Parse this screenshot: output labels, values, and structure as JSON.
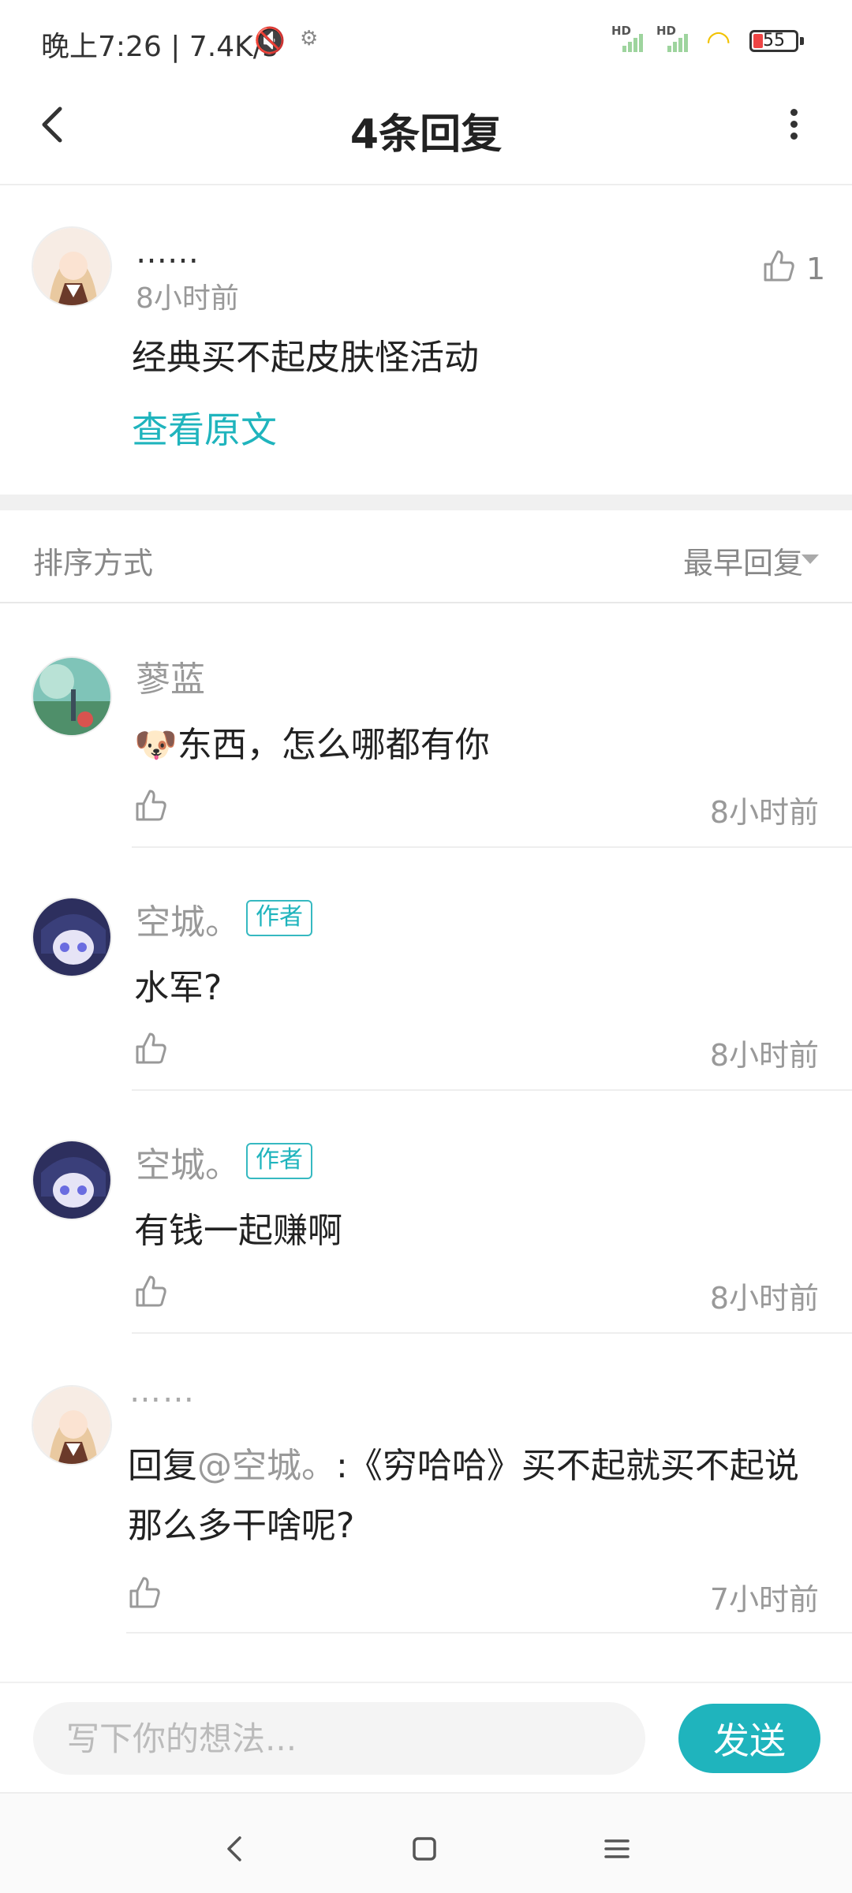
{
  "status_bar": {
    "time": "晚上7:26 | 7.4K/s",
    "sim1": "HD",
    "sim2": "HD",
    "battery": "55"
  },
  "header": {
    "title": "4条回复"
  },
  "main_comment": {
    "name": "……",
    "time": "8小时前",
    "text": "经典买不起皮肤怪活动",
    "view_original": "查看原文",
    "likes": "1"
  },
  "sort": {
    "label": "排序方式",
    "value": "最早回复"
  },
  "replies": [
    {
      "name": "蓼蓝",
      "badge": "",
      "text": "🐶东西，怎么哪都有你",
      "time": "8小时前"
    },
    {
      "name": "空城。",
      "badge": "作者",
      "text": "水军?",
      "time": "8小时前"
    },
    {
      "name": "空城。",
      "badge": "作者",
      "text": "有钱一起赚啊",
      "time": "8小时前"
    },
    {
      "name": "……",
      "badge": "",
      "text_prefix": "回复",
      "mention": "@空城。",
      "text": ":《穷哈哈》买不起就买不起说那么多干啥呢?",
      "time": "7小时前"
    }
  ],
  "composer": {
    "placeholder": "写下你的想法...",
    "send": "发送"
  },
  "colors": {
    "accent": "#1fb4bd",
    "muted": "#999999"
  }
}
